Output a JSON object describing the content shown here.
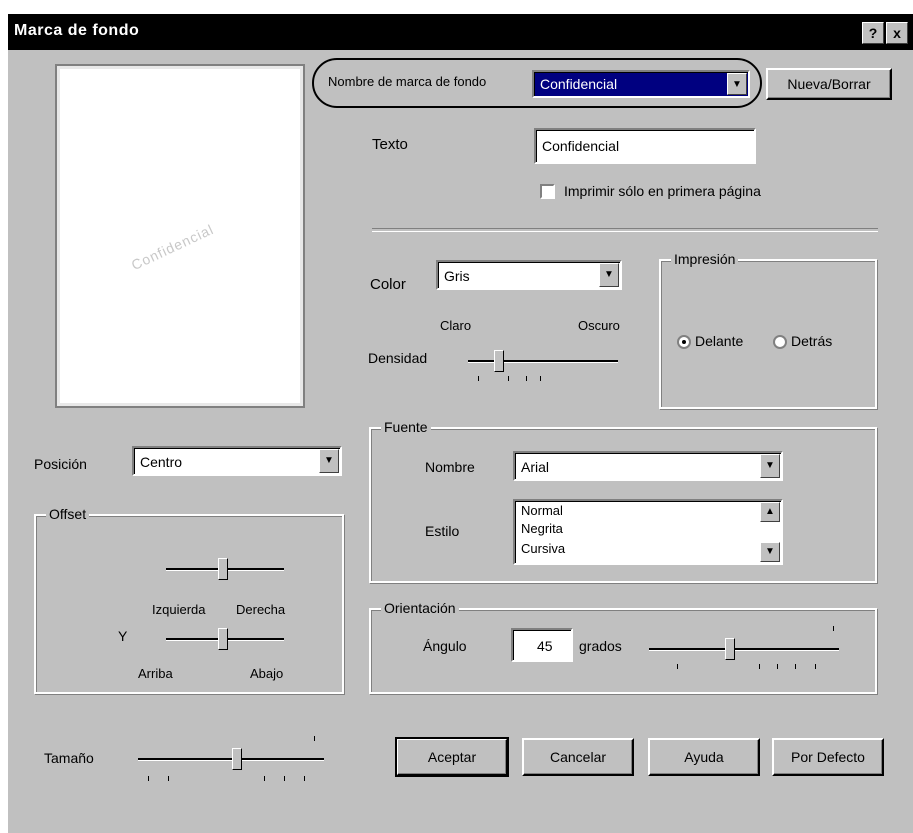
{
  "window": {
    "title": "Marca de fondo",
    "help_btn": "?",
    "close_btn": "x"
  },
  "preview": {
    "watermark_text": "Confidencial"
  },
  "watermark_select": {
    "label": "Nombre de marca de fondo",
    "value": "Confidencial",
    "add_button": "Nueva/Borrar"
  },
  "text_field": {
    "label": "Texto",
    "value": "Confidencial"
  },
  "first_page_checkbox": {
    "label": "Imprimir sólo en primera página",
    "checked": false
  },
  "color": {
    "label": "Color",
    "value": "Gris"
  },
  "density": {
    "label": "Densidad",
    "left_label": "Claro",
    "right_label": "Oscuro",
    "level": 0.25
  },
  "position_group": {
    "label": "Posición",
    "value": "Centro"
  },
  "offset_group": {
    "label": "Offset",
    "x_left": "Izquierda",
    "x_right": "Derecha",
    "y_label": "Y",
    "y_top": "Arriba",
    "y_bottom": "Abajo",
    "x_level": 0.55,
    "y_level": 0.5
  },
  "size": {
    "label": "Tamaño",
    "level": 0.5
  },
  "print_mode": {
    "label": "Impresión",
    "option1": "Delante",
    "option2": "Detrás",
    "selected": "Delante"
  },
  "font_group": {
    "label": "Fuente",
    "name_label": "Nombre",
    "name_value": "Arial",
    "style_label": "Estilo",
    "styles": [
      "Normal",
      "Negrita",
      "Cursiva"
    ]
  },
  "rotation_group": {
    "label": "Orientación",
    "angle_label": "Ángulo",
    "angle_value": "45",
    "degrees_label": "grados",
    "level": 0.5
  },
  "buttons": {
    "ok": "Aceptar",
    "cancel": "Cancelar",
    "help": "Ayuda",
    "default": "Por Defecto"
  }
}
